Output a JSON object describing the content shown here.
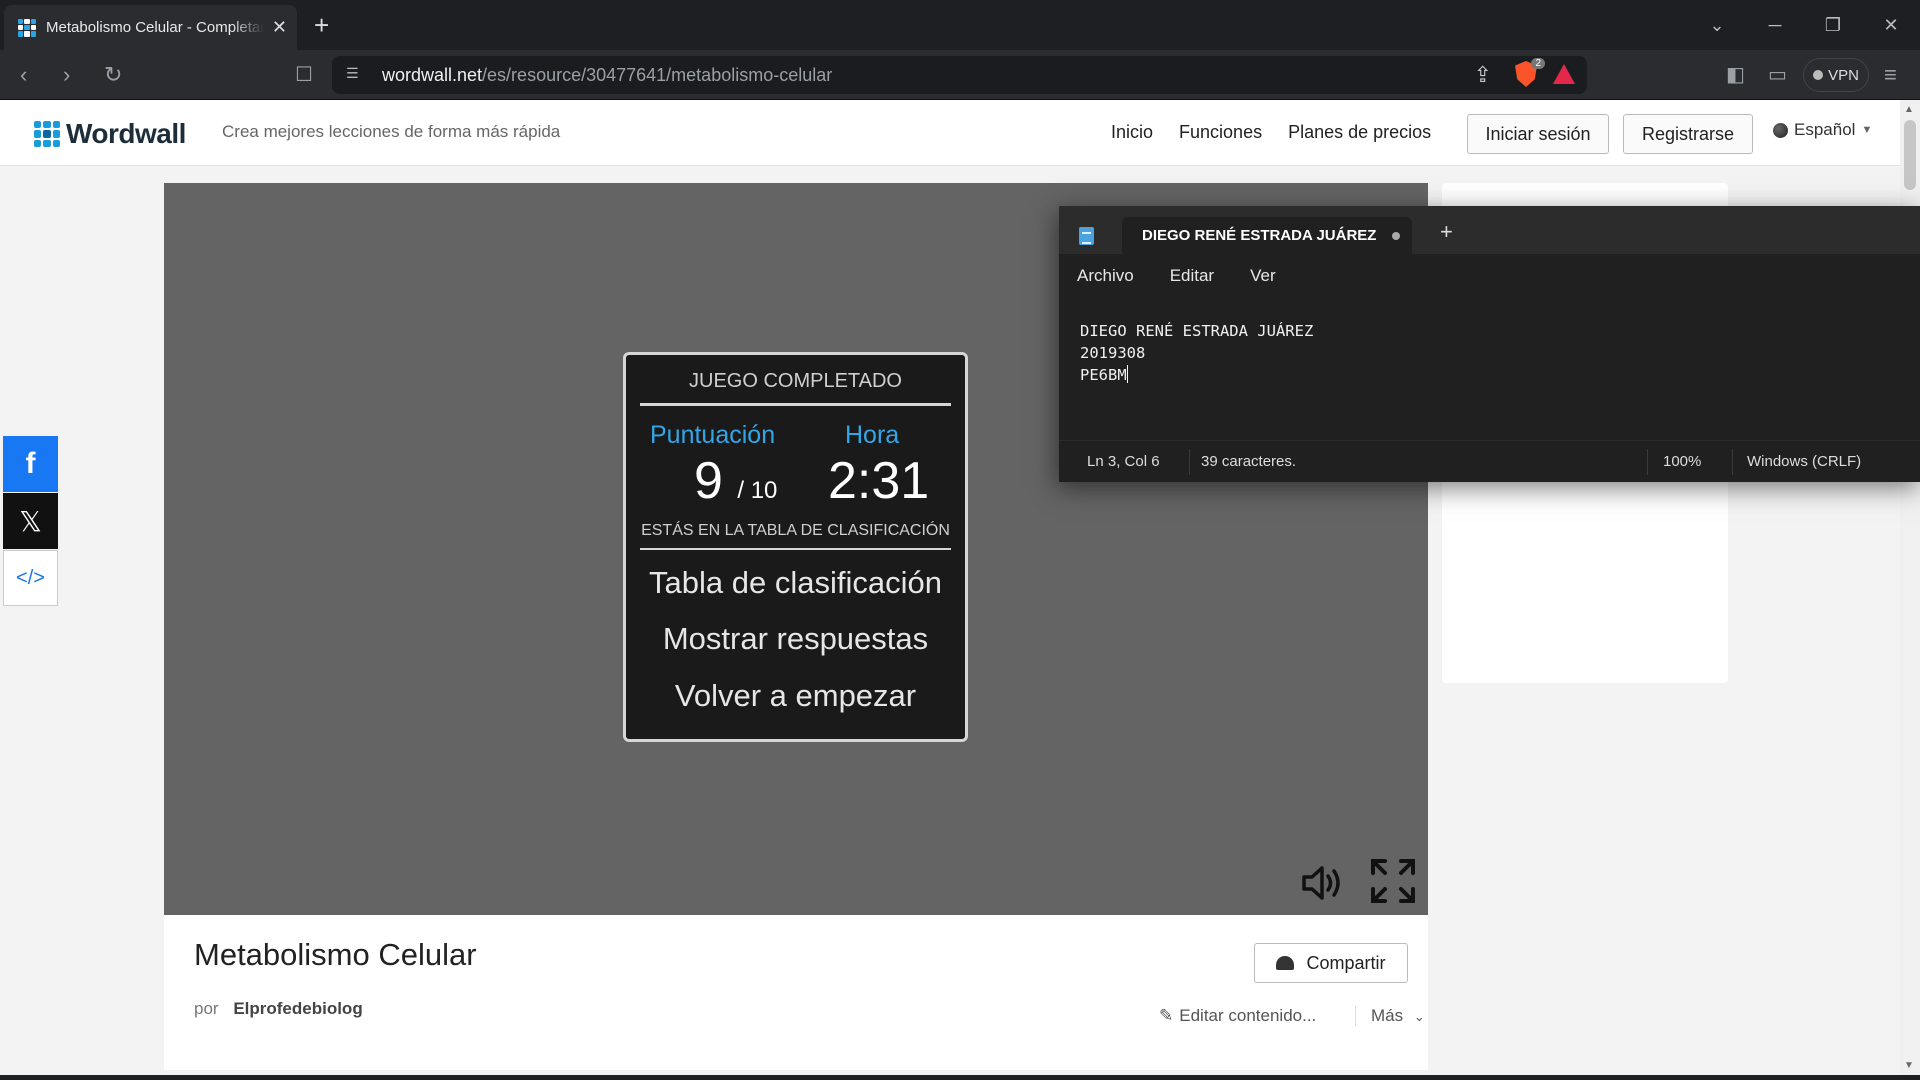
{
  "browser": {
    "tab_title": "Metabolismo Celular - Completar",
    "url_host": "wordwall.net",
    "url_path": "/es/resource/30477641/metabolismo-celular",
    "shield_badge": "2",
    "vpn_label": "VPN"
  },
  "site": {
    "logo_text": "Wordwall",
    "tagline": "Crea mejores lecciones de forma más rápida",
    "nav": [
      "Inicio",
      "Funciones",
      "Planes de precios"
    ],
    "login_label": "Iniciar sesión",
    "register_label": "Registrarse",
    "language": "Español",
    "brand_color": "#1a9bdb"
  },
  "result": {
    "title": "JUEGO COMPLETADO",
    "score_label": "Puntuación",
    "time_label": "Hora",
    "score": "9",
    "score_total": "/ 10",
    "time": "2:31",
    "leaderboard_note": "ESTÁS EN LA TABLA DE CLASIFICACIÓN",
    "options": [
      "Tabla de clasificación",
      "Mostrar respuestas",
      "Volver a empezar"
    ],
    "accent_color": "#33a6e8"
  },
  "activity": {
    "title": "Metabolismo Celular",
    "by_label": "por",
    "author": "Elprofedebiolog",
    "share_label": "Compartir",
    "edit_label": "Editar contenido...",
    "more_label": "Más"
  },
  "social": {
    "facebook": "f",
    "x": "𝕏",
    "embed": "</>"
  },
  "notepad": {
    "tab_title": "DIEGO RENÉ ESTRADA JUÁREZ",
    "menu": [
      "Archivo",
      "Editar",
      "Ver"
    ],
    "lines": [
      "DIEGO RENÉ ESTRADA JUÁREZ",
      "2019308",
      "PE6BM"
    ],
    "status_position": "Ln 3, Col 6",
    "status_chars": "39 caracteres.",
    "status_zoom": "100%",
    "status_eol": "Windows (CRLF)"
  }
}
